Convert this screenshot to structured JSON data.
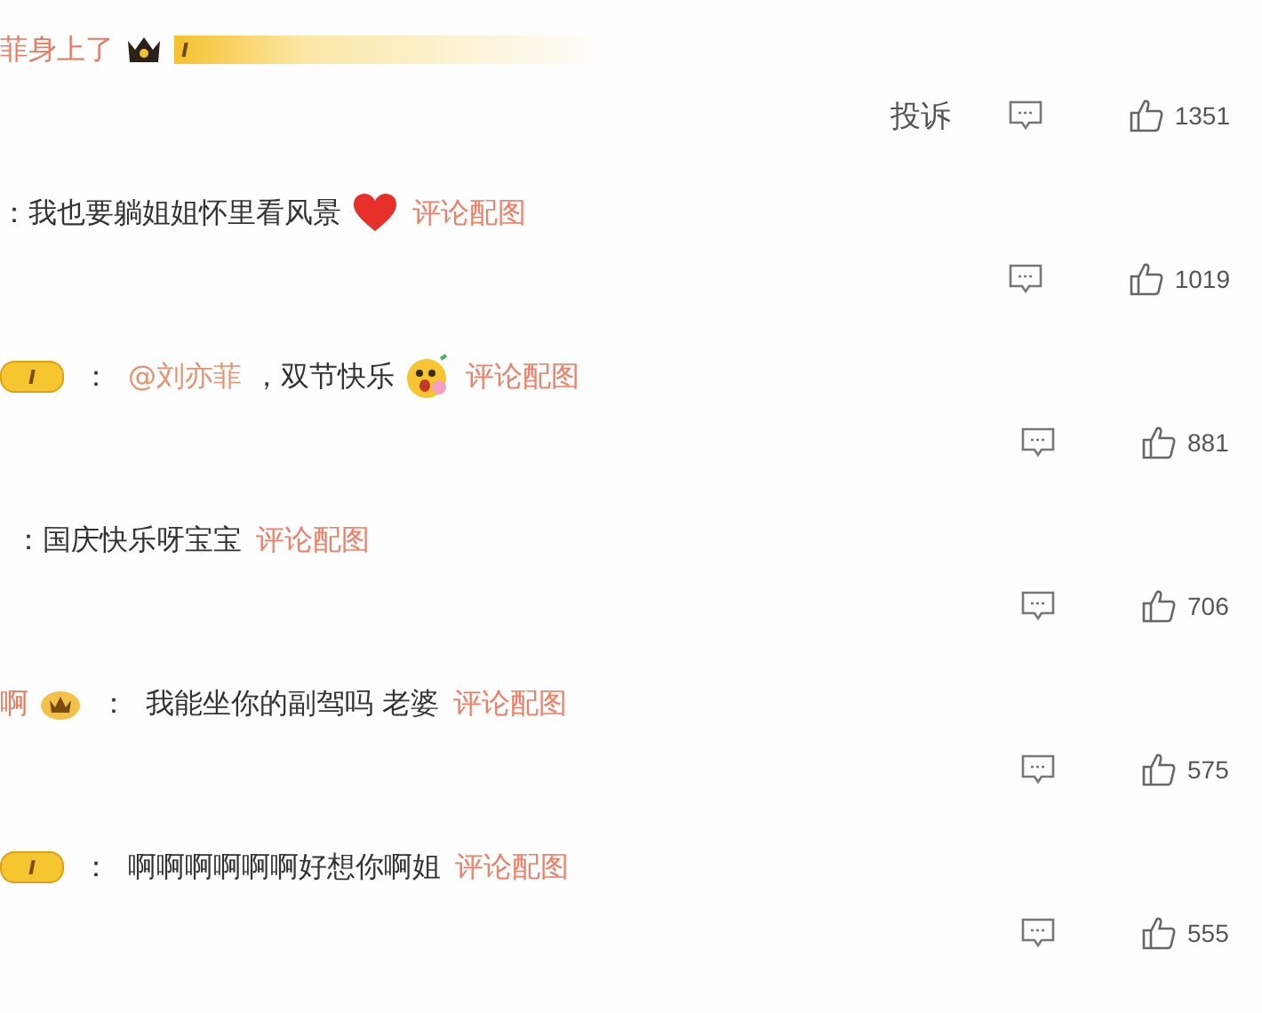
{
  "comments": [
    {
      "user": "菲身上了",
      "badge": {
        "kind": "crown-bar",
        "level": "I"
      },
      "report": "投诉",
      "likes": "1351"
    },
    {
      "text": "：我也要躺姐姐怀里看风景",
      "emoji": {
        "kind": "heart"
      },
      "link": "评论配图",
      "likes": "1019"
    },
    {
      "badge": {
        "kind": "pill",
        "level": "I"
      },
      "colon": "：",
      "mention": "@刘亦菲",
      "text": "，双节快乐",
      "emoji": {
        "kind": "face"
      },
      "link": "评论配图",
      "likes": "881"
    },
    {
      "text": "：国庆快乐呀宝宝",
      "link": "评论配图",
      "likes": "706"
    },
    {
      "user": "啊",
      "badge": {
        "kind": "round"
      },
      "colon": "：",
      "text": "我能坐你的副驾吗 老婆",
      "link": "评论配图",
      "likes": "575"
    },
    {
      "badge": {
        "kind": "pill",
        "level": "I"
      },
      "colon": "：",
      "text": "啊啊啊啊啊啊好想你啊姐",
      "link": "评论配图",
      "likes": "555"
    }
  ]
}
